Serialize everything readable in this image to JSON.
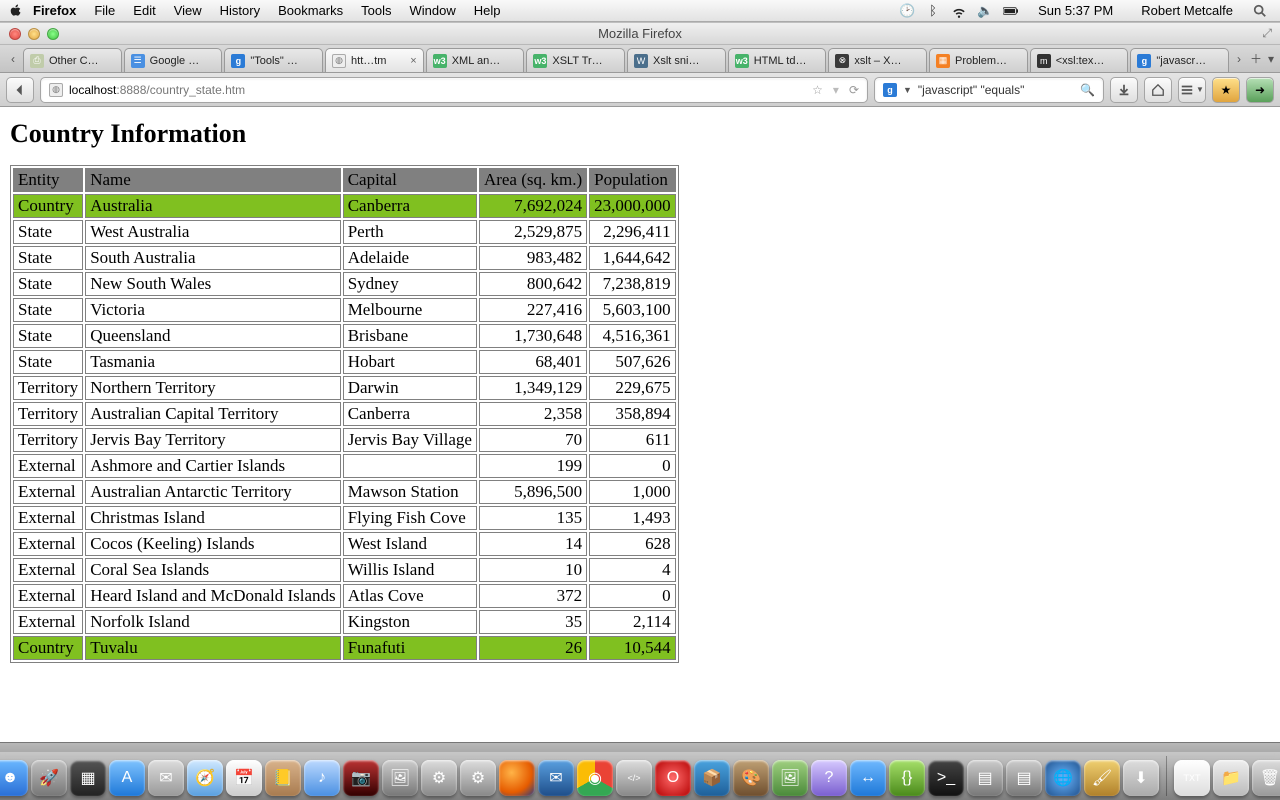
{
  "menubar": {
    "app": "Firefox",
    "items": [
      "File",
      "Edit",
      "View",
      "History",
      "Bookmarks",
      "Tools",
      "Window",
      "Help"
    ],
    "clock": "Sun 5:37 PM",
    "user": "Robert Metcalfe"
  },
  "window": {
    "title": "Mozilla Firefox"
  },
  "tabs": [
    {
      "label": "Other C…",
      "icon": "generic"
    },
    {
      "label": "Google …",
      "icon": "goog"
    },
    {
      "label": "\"Tools\" …",
      "icon": "g"
    },
    {
      "label": "htt…tm",
      "icon": "globe",
      "active": true,
      "closeable": true
    },
    {
      "label": "XML an…",
      "icon": "w3"
    },
    {
      "label": "XSLT Tr…",
      "icon": "w3"
    },
    {
      "label": "Xslt sni…",
      "icon": "wp"
    },
    {
      "label": "HTML td…",
      "icon": "w3"
    },
    {
      "label": "xslt – X…",
      "icon": "x"
    },
    {
      "label": "Problem…",
      "icon": "so"
    },
    {
      "label": "<xsl:tex…",
      "icon": "msdn"
    },
    {
      "label": "\"javascr…",
      "icon": "g"
    }
  ],
  "url": {
    "host": "localhost",
    "port": ":8888",
    "path": "/country_state.htm"
  },
  "search": {
    "text": "\"javascript\" \"equals\""
  },
  "page": {
    "heading": "Country Information",
    "columns": [
      "Entity",
      "Name",
      "Capital",
      "Area (sq. km.)",
      "Population"
    ],
    "rows": [
      {
        "hl": true,
        "c": [
          "Country",
          "Australia",
          "Canberra",
          "7,692,024",
          "23,000,000"
        ]
      },
      {
        "c": [
          "State",
          "West Australia",
          "Perth",
          "2,529,875",
          "2,296,411"
        ]
      },
      {
        "c": [
          "State",
          "South Australia",
          "Adelaide",
          "983,482",
          "1,644,642"
        ]
      },
      {
        "c": [
          "State",
          "New South Wales",
          "Sydney",
          "800,642",
          "7,238,819"
        ]
      },
      {
        "c": [
          "State",
          "Victoria",
          "Melbourne",
          "227,416",
          "5,603,100"
        ]
      },
      {
        "c": [
          "State",
          "Queensland",
          "Brisbane",
          "1,730,648",
          "4,516,361"
        ]
      },
      {
        "c": [
          "State",
          "Tasmania",
          "Hobart",
          "68,401",
          "507,626"
        ]
      },
      {
        "c": [
          "Territory",
          "Northern Territory",
          "Darwin",
          "1,349,129",
          "229,675"
        ]
      },
      {
        "c": [
          "Territory",
          "Australian Capital Territory",
          "Canberra",
          "2,358",
          "358,894"
        ]
      },
      {
        "c": [
          "Territory",
          "Jervis Bay Territory",
          "Jervis Bay Village",
          "70",
          "611"
        ]
      },
      {
        "c": [
          "External",
          "Ashmore and Cartier Islands",
          "",
          "199",
          "0"
        ]
      },
      {
        "c": [
          "External",
          "Australian Antarctic Territory",
          "Mawson Station",
          "5,896,500",
          "1,000"
        ]
      },
      {
        "c": [
          "External",
          "Christmas Island",
          "Flying Fish Cove",
          "135",
          "1,493"
        ]
      },
      {
        "c": [
          "External",
          "Cocos (Keeling) Islands",
          "West Island",
          "14",
          "628"
        ]
      },
      {
        "c": [
          "External",
          "Coral Sea Islands",
          "Willis Island",
          "10",
          "4"
        ]
      },
      {
        "c": [
          "External",
          "Heard Island and McDonald Islands",
          "Atlas Cove",
          "372",
          "0"
        ]
      },
      {
        "c": [
          "External",
          "Norfolk Island",
          "Kingston",
          "35",
          "2,114"
        ]
      },
      {
        "hl": true,
        "c": [
          "Country",
          "Tuvalu",
          "Funafuti",
          "26",
          "10,544"
        ]
      }
    ]
  },
  "dock": [
    {
      "name": "finder",
      "bg": "linear-gradient(#6ab7ff,#2a6fd6)",
      "glyph": "☻"
    },
    {
      "name": "launchpad",
      "bg": "linear-gradient(#c0c0c0,#777)",
      "glyph": "🚀"
    },
    {
      "name": "mission-control",
      "bg": "linear-gradient(#555,#222)",
      "glyph": "▦"
    },
    {
      "name": "appstore",
      "bg": "linear-gradient(#7fc3ff,#1e78d8)",
      "glyph": "A"
    },
    {
      "name": "mail",
      "bg": "linear-gradient(#dcdcdc,#999)",
      "glyph": "✉"
    },
    {
      "name": "safari",
      "bg": "linear-gradient(#cfe8ff,#5aa0e0)",
      "glyph": "🧭"
    },
    {
      "name": "ical",
      "bg": "linear-gradient(#fff,#ccc)",
      "glyph": "📅"
    },
    {
      "name": "contacts",
      "bg": "linear-gradient(#d9b38c,#a87b4f)",
      "glyph": "📒"
    },
    {
      "name": "itunes",
      "bg": "linear-gradient(#bcd9ff,#4a90e2)",
      "glyph": "♪"
    },
    {
      "name": "iphoto",
      "bg": "linear-gradient(#b33,#300)",
      "glyph": "📷"
    },
    {
      "name": "preview",
      "bg": "linear-gradient(#ccc,#777)",
      "glyph": "🖼"
    },
    {
      "name": "automator",
      "bg": "linear-gradient(#ddd,#888)",
      "glyph": "⚙"
    },
    {
      "name": "sysprefs",
      "bg": "linear-gradient(#ddd,#888)",
      "glyph": "⚙"
    },
    {
      "name": "firefox",
      "bg": "radial-gradient(circle at 35% 35%,#ffb347,#e65c00 60%,#1e3a8a)",
      "glyph": ""
    },
    {
      "name": "thunderbird",
      "bg": "linear-gradient(#5aa0e0,#1e4e8a)",
      "glyph": "✉"
    },
    {
      "name": "chrome",
      "bg": "conic-gradient(#ea4335 0 120deg,#34a853 120deg 240deg,#fbbc05 240deg 360deg)",
      "glyph": "◉"
    },
    {
      "name": "dev",
      "bg": "linear-gradient(#ddd,#888)",
      "glyph": "</>"
    },
    {
      "name": "opera",
      "bg": "radial-gradient(#ff6a6a,#b30000)",
      "glyph": "O"
    },
    {
      "name": "vbox",
      "bg": "linear-gradient(#4aa3df,#1e5f99)",
      "glyph": "📦"
    },
    {
      "name": "gimp",
      "bg": "linear-gradient(#bfa074,#6e4e2e)",
      "glyph": "🎨"
    },
    {
      "name": "image",
      "bg": "linear-gradient(#a0d080,#4a8a3a)",
      "glyph": "🖼"
    },
    {
      "name": "help",
      "bg": "linear-gradient(#d6c9ff,#7a5fd0)",
      "glyph": "?"
    },
    {
      "name": "teamviewer",
      "bg": "linear-gradient(#6fb9ff,#1e78d8)",
      "glyph": "↔"
    },
    {
      "name": "code",
      "bg": "linear-gradient(#a6e06a,#4a8a1a)",
      "glyph": "{}"
    },
    {
      "name": "terminal",
      "bg": "linear-gradient(#444,#111)",
      "glyph": ">_"
    },
    {
      "name": "util1",
      "bg": "linear-gradient(#ccc,#777)",
      "glyph": "▤"
    },
    {
      "name": "util2",
      "bg": "linear-gradient(#ccc,#777)",
      "glyph": "▤"
    },
    {
      "name": "globe",
      "bg": "radial-gradient(#6ab7ff,#1e4e8a)",
      "glyph": "🌐"
    },
    {
      "name": "brush",
      "bg": "linear-gradient(#f0d070,#b0802a)",
      "glyph": "🖌"
    },
    {
      "name": "dl",
      "bg": "linear-gradient(#ddd,#aaa)",
      "glyph": "⬇"
    },
    {
      "name": "txt",
      "bg": "linear-gradient(#fff,#ddd)",
      "glyph": "TXT"
    },
    {
      "name": "folder",
      "bg": "linear-gradient(#eee,#bbb)",
      "glyph": "📁"
    },
    {
      "name": "trash",
      "bg": "linear-gradient(#ddd,#999)",
      "glyph": "🗑"
    }
  ]
}
